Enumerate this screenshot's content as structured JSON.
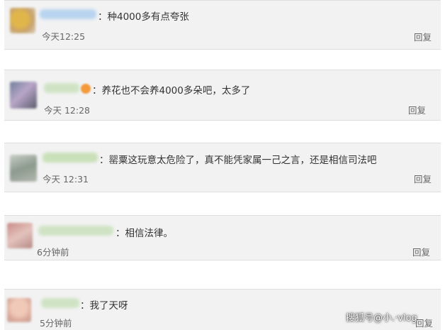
{
  "comments": [
    {
      "username": "",
      "text": "：种4000多有点夸张",
      "time": "今天12:25",
      "reply": "回复"
    },
    {
      "username": "",
      "text": "：养花也不会养4000多朵吧，太多了",
      "time": "今天 12:28",
      "reply": "回复"
    },
    {
      "username": "",
      "text": "：罂粟这玩意太危险了，真不能凭家属一己之言，还是相信司法吧",
      "time": "今天 12:31",
      "reply": "回复"
    },
    {
      "username": "",
      "text": "：相信法律。",
      "time": "6分钟前",
      "reply": "回复"
    },
    {
      "username": "",
      "text": "：我了天呀",
      "time": "5分钟前",
      "reply": "回复"
    }
  ],
  "watermark": "搜狐号@小.·vlog"
}
